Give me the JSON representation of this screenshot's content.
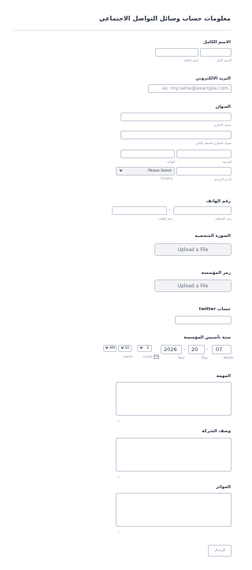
{
  "form": {
    "title": "معلومات حساب وسائل التواصل الاجتماعي"
  },
  "full_name": {
    "label": "الاسم الكامل",
    "first_sub": "الاسم الأول",
    "last_sub": "اسم العائلة"
  },
  "email": {
    "label": "البريد الالكتروني",
    "placeholder": "ex: myname@example.com"
  },
  "address": {
    "label": "العنوان",
    "street_sub": "عنوان الشارع",
    "street2_sub": "عنوان الشارع السطر الثاني",
    "city_sub": "المدينة",
    "state_sub": "الولاية",
    "postal_sub": "الرمز البريدي",
    "country_value": "Please Select",
    "country_sub": "Country"
  },
  "phone": {
    "label": "رقم الهاتف",
    "separator": "-",
    "area_sub": "رمز المنطقة",
    "number_sub": "رقم الهاتف"
  },
  "photo": {
    "label": "الصورة الشخصية",
    "button": "Upload a File"
  },
  "logo": {
    "label": "رمز المؤسسة",
    "button": "Upload a File"
  },
  "twitter": {
    "label": "حساب twitter"
  },
  "founded": {
    "label": "سنة تأسيس المؤسسة",
    "month_value": "07",
    "day_value": "20",
    "year_value": "2026",
    "month_sub": "Month",
    "day_sub": "Day",
    "year_sub": "Year",
    "separator": "-",
    "hour_value": "3",
    "minute_value": "50",
    "ampm_value": "AM",
    "hour_sub": "الساعة",
    "minute_sub": "الدقيقة",
    "time_separator": ":"
  },
  "mission": {
    "label": "المهمة"
  },
  "company_description": {
    "label": "وصف الشركة"
  },
  "awards": {
    "label": "الجوائز"
  },
  "submit": {
    "label": "الإرسال"
  },
  "icons": {
    "select_chevron": "chevron-down-icon",
    "calendar": "calendar-icon",
    "resize": "resize-grip-icon"
  },
  "colors": {
    "border": "#c3cad8",
    "text": "#2c3345",
    "muted": "#8c92a6",
    "button_bg": "#f3f3f5"
  }
}
